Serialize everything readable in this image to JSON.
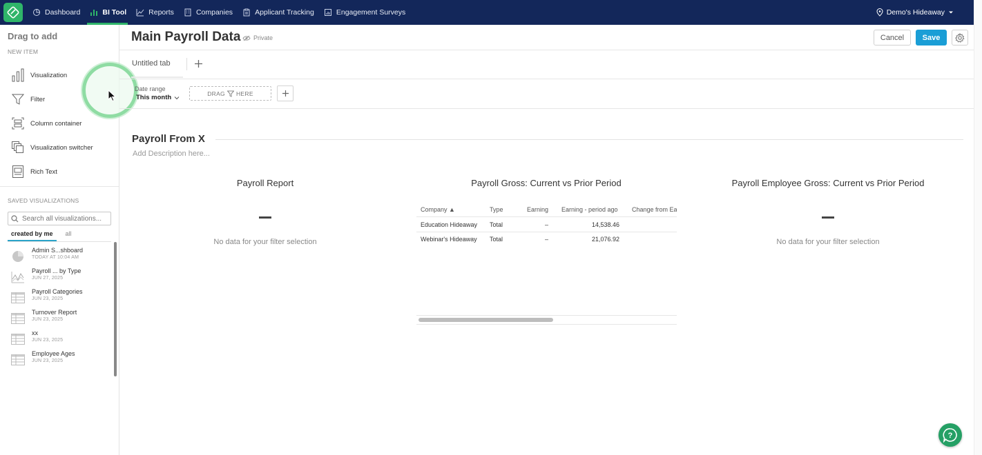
{
  "nav": {
    "items": [
      {
        "label": "Dashboard",
        "icon": "dashboard-icon",
        "active": false
      },
      {
        "label": "BI Tool",
        "icon": "bar-chart-icon",
        "active": true
      },
      {
        "label": "Reports",
        "icon": "line-chart-icon",
        "active": false
      },
      {
        "label": "Companies",
        "icon": "building-icon",
        "active": false
      },
      {
        "label": "Applicant Tracking",
        "icon": "clipboard-icon",
        "active": false
      },
      {
        "label": "Engagement Surveys",
        "icon": "survey-icon",
        "active": false
      }
    ],
    "company": "Demo's Hideaway"
  },
  "sidebar": {
    "title": "Drag to add",
    "new_item_label": "NEW ITEM",
    "new_items": [
      {
        "label": "Visualization",
        "icon": "bar-chart-icon"
      },
      {
        "label": "Filter",
        "icon": "funnel-icon"
      },
      {
        "label": "Column container",
        "icon": "column-container-icon"
      },
      {
        "label": "Visualization switcher",
        "icon": "switcher-icon"
      },
      {
        "label": "Rich Text",
        "icon": "rich-text-icon"
      }
    ],
    "saved_label": "SAVED VISUALIZATIONS",
    "search_placeholder": "Search all visualizations...",
    "filter_tabs": [
      "created by me",
      "all"
    ],
    "saved": [
      {
        "name": "Admin S...shboard",
        "date": "TODAY AT 10:04 AM",
        "icon": "pie-chart-icon"
      },
      {
        "name": "Payroll ... by Type",
        "date": "JUN 27, 2025",
        "icon": "line-chart-icon"
      },
      {
        "name": "Payroll Categories",
        "date": "JUN 23, 2025",
        "icon": "table-icon"
      },
      {
        "name": "Turnover Report",
        "date": "JUN 23, 2025",
        "icon": "table-icon"
      },
      {
        "name": "xx",
        "date": "JUN 23, 2025",
        "icon": "table-icon"
      },
      {
        "name": "Employee Ages",
        "date": "JUN 23, 2025",
        "icon": "table-icon"
      }
    ]
  },
  "header": {
    "title": "Main Payroll Data",
    "privacy": "Private",
    "cancel": "Cancel",
    "save": "Save"
  },
  "tabs": {
    "current": "Untitled tab"
  },
  "filters": {
    "date_label": "Date range",
    "date_value": "This month",
    "drag_left": "DRAG",
    "drag_right": "HERE"
  },
  "section": {
    "title": "Payroll From X",
    "description": "Add Description here..."
  },
  "viz": [
    {
      "title": "Payroll Report",
      "empty": "No data for your filter selection"
    },
    {
      "title": "Payroll Gross: Current vs Prior Period"
    },
    {
      "title": "Payroll Employee Gross: Current vs Prior Period",
      "empty": "No data for your filter selection"
    }
  ],
  "table": {
    "columns": [
      "Company ▲",
      "Type",
      "Earning",
      "Earning - period ago",
      "Change from Ea"
    ],
    "rows": [
      [
        "Education Hideaway",
        "Total",
        "–",
        "14,538.46",
        ""
      ],
      [
        "Webinar's Hideaway",
        "Total",
        "–",
        "21,076.92",
        ""
      ]
    ]
  },
  "colors": {
    "nav_bg": "#13275a",
    "accent_green": "#2fb56a",
    "save_blue": "#1a9ed6"
  }
}
